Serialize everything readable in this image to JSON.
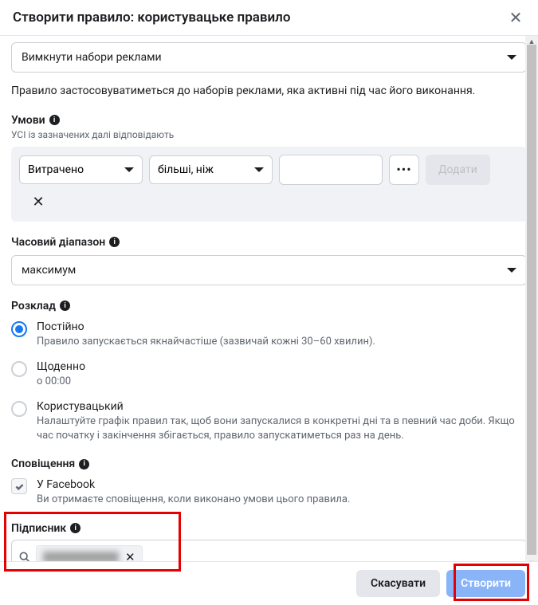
{
  "header": {
    "title": "Створити правило: користувацьке правило"
  },
  "action": {
    "selected": "Вимкнути набори реклами"
  },
  "description": "Правило застосовуватиметься до наборів реклами, яка активні під час його виконання.",
  "conditions": {
    "label": "Умови",
    "hint": "УСІ із зазначених далі відповідають",
    "metric": "Витрачено",
    "operator": "більші, ніж",
    "value": "",
    "add_label": "Додати"
  },
  "timerange": {
    "label": "Часовий діапазон",
    "selected": "максимум"
  },
  "schedule": {
    "label": "Розклад",
    "options": [
      {
        "title": "Постійно",
        "desc": "Правило запускається якнайчастіше (зазвичай кожні 30–60 хвилин)."
      },
      {
        "title": "Щоденно",
        "desc": "о 00:00"
      },
      {
        "title": "Користувацький",
        "desc": "Налаштуйте графік правил так, щоб вони запускалися в конкретні дні та в певний час доби. Якщо час початку і закінчення збігається, правило запускатиметься раз на день."
      }
    ]
  },
  "notification": {
    "label": "Сповіщення",
    "option_title": "У Facebook",
    "option_desc": "Ви отримаєте сповіщення, коли виконано умови цього правила."
  },
  "subscriber": {
    "label": "Підписник"
  },
  "footer": {
    "cancel": "Скасувати",
    "create": "Створити"
  }
}
